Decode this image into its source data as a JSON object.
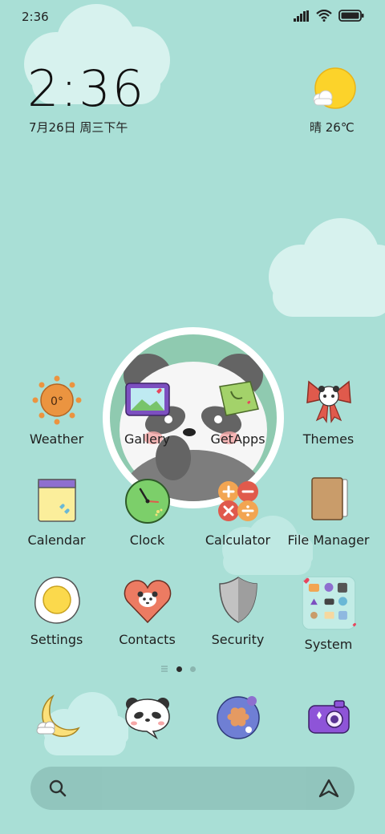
{
  "status_bar": {
    "time": "2:36"
  },
  "clock_widget": {
    "time": "2:36",
    "date": "7月26日 周三下午"
  },
  "weather_widget": {
    "text": "晴 26℃"
  },
  "apps": {
    "weather": {
      "label": "Weather",
      "temp": "0°"
    },
    "gallery": {
      "label": "Gallery"
    },
    "getapps": {
      "label": "GetApps"
    },
    "themes": {
      "label": "Themes"
    },
    "calendar": {
      "label": "Calendar"
    },
    "clock": {
      "label": "Clock"
    },
    "calculator": {
      "label": "Calculator"
    },
    "file_manager": {
      "label": "File Manager"
    },
    "settings": {
      "label": "Settings"
    },
    "contacts": {
      "label": "Contacts"
    },
    "security": {
      "label": "Security"
    },
    "system": {
      "label": "System"
    }
  },
  "page_indicator": {
    "pages": 2,
    "current": 1
  },
  "dock": [
    "moon-app-icon",
    "panda-message-icon",
    "browser-icon",
    "camera-icon"
  ],
  "colors": {
    "background": "#a9dfd6",
    "cloud": "#d6f2ef"
  }
}
